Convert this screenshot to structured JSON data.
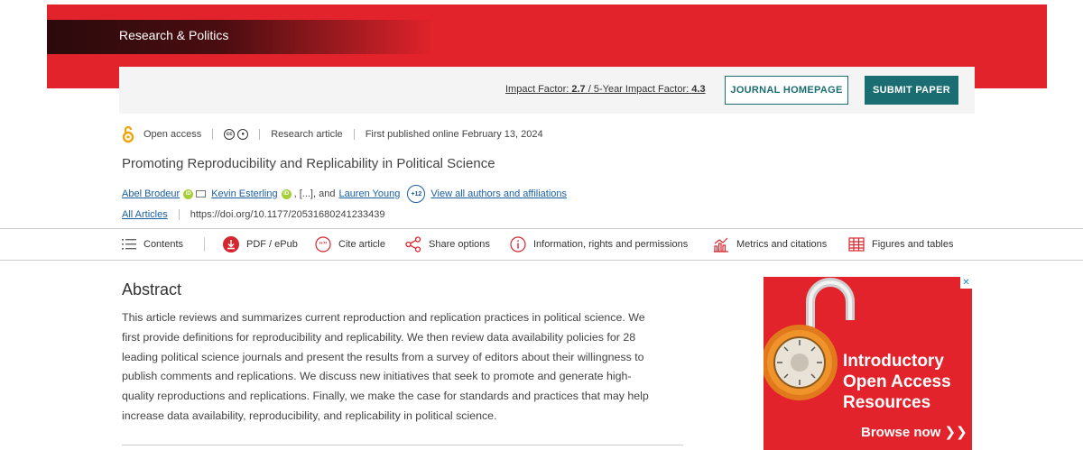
{
  "banner": {
    "journal_title": "Research & Politics"
  },
  "infobar": {
    "impact_label": "Impact Factor:",
    "impact_value": "2.7",
    "sep": "/",
    "five_year_label": "5-Year Impact Factor:",
    "five_year_value": "4.3",
    "journal_homepage": "JOURNAL HOMEPAGE",
    "submit_paper": "SUBMIT PAPER"
  },
  "meta": {
    "open_access": "Open access",
    "license_icons": [
      "cc",
      "by"
    ],
    "article_type": "Research article",
    "published": "First published online February 13, 2024"
  },
  "article": {
    "title": "Promoting Reproducibility and Replicability in Political Science",
    "authors": [
      "Abel Brodeur",
      "Kevin Esterling",
      "Lauren Young"
    ],
    "ellipsis": ", [...], and",
    "more_count": "+12",
    "view_all": "View all authors and affiliations",
    "all_articles": "All Articles",
    "doi": "https://doi.org/10.1177/20531680241233439"
  },
  "tools": [
    {
      "label": "Contents",
      "icon": "list-icon"
    },
    {
      "label": "PDF / ePub",
      "icon": "download-icon"
    },
    {
      "label": "Cite article",
      "icon": "quote-icon"
    },
    {
      "label": "Share options",
      "icon": "share-icon"
    },
    {
      "label": "Information, rights and permissions",
      "icon": "info-icon"
    },
    {
      "label": "Metrics and citations",
      "icon": "metrics-icon"
    },
    {
      "label": "Figures and tables",
      "icon": "table-icon"
    }
  ],
  "abstract": {
    "heading": "Abstract",
    "lines": [
      "This article reviews and summarizes current reproduction and replication practices in political science. We",
      "first provide definitions for reproducibility and replicability. We then review data availability policies for 28",
      "leading political science journals and present the results from a survey of editors about their willingness to",
      "publish comments and replications. We discuss new initiatives that seek to promote and generate high-",
      "quality reproductions and replications. Finally, we make the case for standards and practices that may help",
      "increase data availability, reproducibility, and replicability in political science."
    ]
  },
  "ad": {
    "close": "✕",
    "headline": [
      "Introductory",
      "Open Access",
      "Resources"
    ],
    "browse": "Browse now ❯❯"
  },
  "colors": {
    "brand_red": "#e3232b",
    "teal": "#1a6e72",
    "link": "#1a5fa3"
  }
}
